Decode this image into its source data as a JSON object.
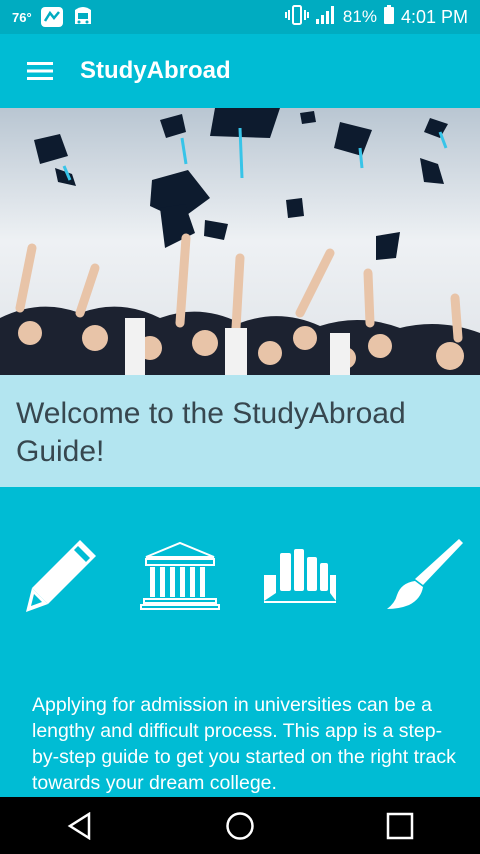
{
  "status_bar": {
    "temperature": "76°",
    "battery_percent": "81%",
    "time": "4:01 PM",
    "icons": [
      "weather-app-icon",
      "bus-app-icon",
      "vibrate-icon",
      "signal-icon",
      "battery-icon"
    ]
  },
  "app_bar": {
    "title": "StudyAbroad",
    "menu_icon": "hamburger-menu-icon"
  },
  "hero": {
    "image": "graduation-caps-photo"
  },
  "welcome": {
    "text": "Welcome to the StudyAbroad Guide!"
  },
  "features": [
    {
      "icon": "pencil-icon"
    },
    {
      "icon": "university-building-icon"
    },
    {
      "icon": "books-icon"
    },
    {
      "icon": "paintbrush-icon"
    }
  ],
  "description": "Applying for admission in universities can be a lengthy and difficult process. This app is a step-by-step guide to get you started on the right track towards your dream college.",
  "nav_bar": {
    "buttons": [
      "back-icon",
      "home-icon",
      "recents-icon"
    ]
  },
  "colors": {
    "primary": "#00bcd4",
    "status_bar": "#00acc1",
    "welcome_bg": "#b3e5f0",
    "welcome_text": "#37474f"
  }
}
